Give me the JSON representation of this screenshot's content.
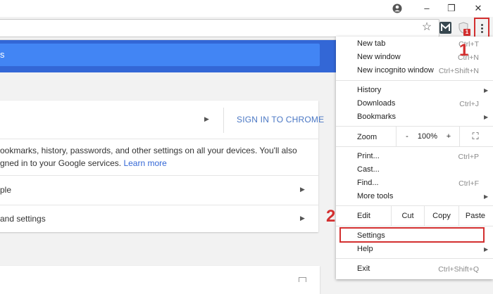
{
  "window": {
    "account_icon": "account-circle-icon",
    "minimize": "–",
    "restore": "❐",
    "close": "✕"
  },
  "toolbar": {
    "star": "☆",
    "ext_m_letter": "M",
    "shield_badge": "1"
  },
  "page": {
    "header_text": "s",
    "sign_in_label": "SIGN IN TO CHROME",
    "description_line1": "ookmarks, history, passwords, and other settings on all your devices. You'll also",
    "description_line2": "gned in to your Google services. ",
    "learn_more": "Learn more",
    "row1_label": "ple",
    "row2_label": "and settings"
  },
  "menu": {
    "new_tab": "New tab",
    "new_tab_shortcut": "Ctrl+T",
    "new_window": "New window",
    "new_window_shortcut": "Ctrl+N",
    "new_incognito": "New incognito window",
    "new_incognito_shortcut": "Ctrl+Shift+N",
    "history": "History",
    "downloads": "Downloads",
    "downloads_shortcut": "Ctrl+J",
    "bookmarks": "Bookmarks",
    "zoom_label": "Zoom",
    "zoom_minus": "-",
    "zoom_value": "100%",
    "zoom_plus": "+",
    "fullscreen": "⛶",
    "print": "Print...",
    "print_shortcut": "Ctrl+P",
    "cast": "Cast...",
    "find": "Find...",
    "find_shortcut": "Ctrl+F",
    "more_tools": "More tools",
    "edit_label": "Edit",
    "cut": "Cut",
    "copy": "Copy",
    "paste": "Paste",
    "settings": "Settings",
    "help": "Help",
    "exit": "Exit",
    "exit_shortcut": "Ctrl+Shift+Q"
  },
  "annotations": {
    "step1": "1",
    "step2": "2"
  },
  "colors": {
    "accent_blue": "#3367d6",
    "highlight_red": "#d32f2f",
    "link": "#4a77c4"
  }
}
